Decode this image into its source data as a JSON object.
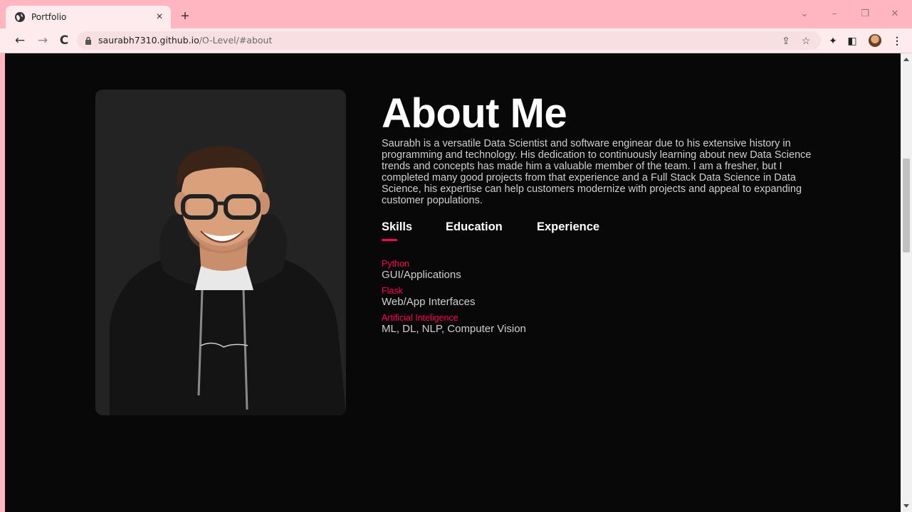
{
  "browser": {
    "tab_title": "Portfolio",
    "tab_close": "×",
    "new_tab": "+",
    "url_host": "saurabh7310.github.io",
    "url_path": "/O-Level/#about",
    "window_controls": {
      "dropdown": "⌄",
      "minimize": "–",
      "restore": "❐",
      "close": "✕"
    },
    "nav": {
      "back": "←",
      "forward": "→",
      "reload": "C"
    },
    "icons": {
      "share": "⇪",
      "bookmark": "☆",
      "extensions": "✦",
      "sidepanel": "◧",
      "menu": "⋮"
    }
  },
  "about": {
    "title": "About Me",
    "bio": "Saurabh is a versatile Data Scientist and software enginear due to his extensive history in programming and technology. His dedication to continuously learning about new Data Science trends and concepts has made him a valuable member of the team. I am a fresher, but I completed many good projects from that experience and a Full Stack Data Science in Data Science, his expertise can help customers modernize with projects and appeal to expanding customer populations.",
    "tabs": [
      {
        "label": "Skills",
        "active": true
      },
      {
        "label": "Education",
        "active": false
      },
      {
        "label": "Experience",
        "active": false
      }
    ],
    "skills": [
      {
        "name": "Python",
        "desc": "GUI/Applications"
      },
      {
        "name": "Flask",
        "desc": "Web/App Interfaces"
      },
      {
        "name": "Artificial Inteligence",
        "desc": "ML, DL, NLP, Computer Vision"
      }
    ],
    "accent_color": "#ff004f"
  }
}
